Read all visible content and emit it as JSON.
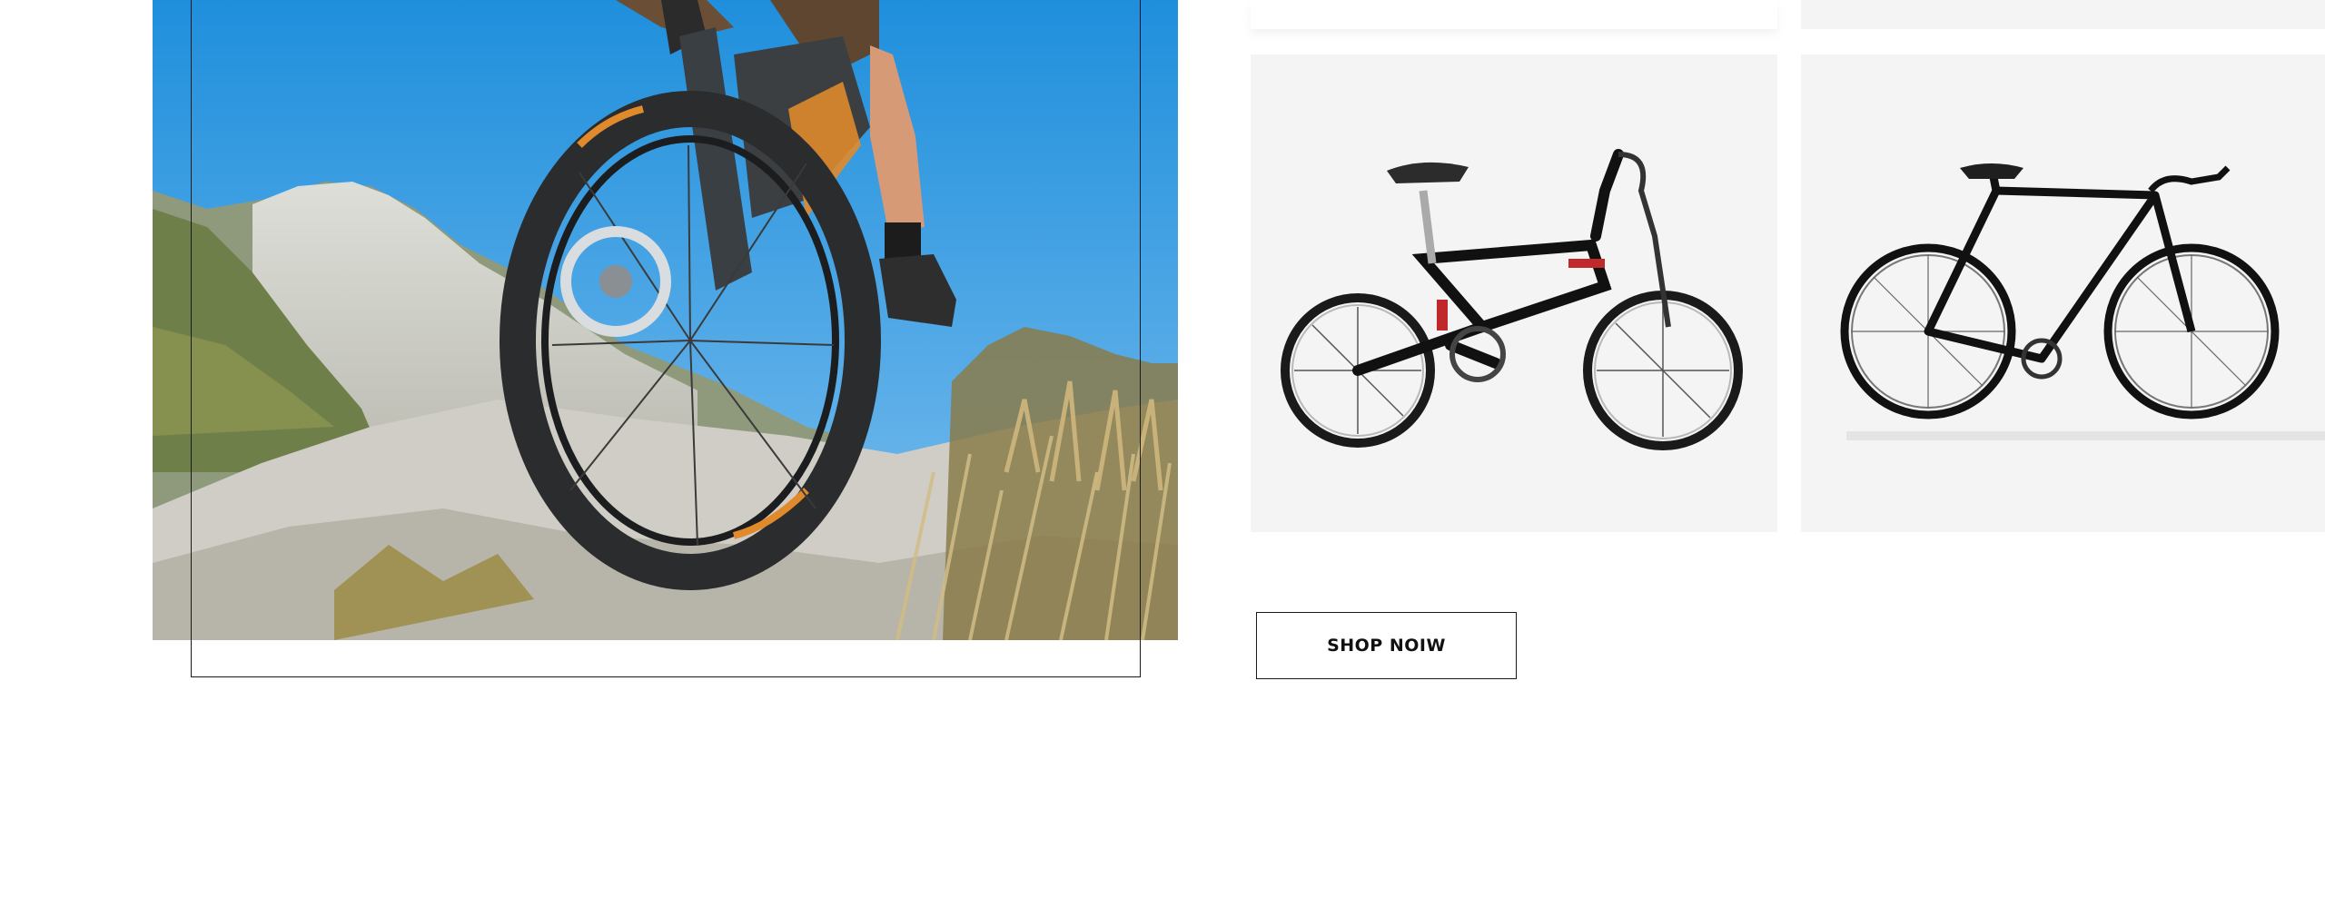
{
  "hero": {
    "image": "mountain-biker-on-rocky-summit"
  },
  "products": [
    {
      "image": "black-folding-bike"
    },
    {
      "image": "black-fixed-gear-bike"
    }
  ],
  "cta": {
    "label": "SHOP NOIW"
  },
  "colors": {
    "sky_top": "#1f8fdc",
    "sky_bottom": "#7fc0ef",
    "card_bg": "#f4f4f4",
    "frame": "#1a1a1a",
    "tire_accent": "#e08a2c"
  }
}
